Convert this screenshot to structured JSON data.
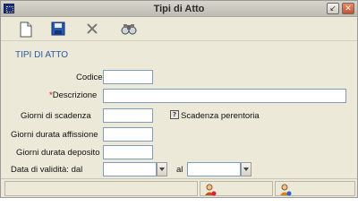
{
  "window": {
    "title": "Tipi di Atto",
    "min_glyph": "↙",
    "close_glyph": "✕"
  },
  "toolbar": {
    "items": [
      {
        "name": "new-document-icon"
      },
      {
        "name": "save-icon"
      },
      {
        "name": "delete-icon"
      },
      {
        "name": "search-binoculars-icon"
      }
    ]
  },
  "form": {
    "section_title": "TIPI DI ATTO",
    "codice_label": "Codice",
    "codice_value": "",
    "descrizione_required_mark": "*",
    "descrizione_label": "Descrizione",
    "descrizione_value": "",
    "giorni_scadenza_label": "Giorni di scadenza",
    "giorni_scadenza_value": "",
    "scadenza_perentoria_label": "Scadenza perentoria",
    "help_glyph": "?",
    "giorni_affissione_label": "Giorni durata affissione",
    "giorni_affissione_value": "",
    "giorni_deposito_label": "Giorni durata deposito",
    "giorni_deposito_value": "",
    "validita_dal_label": "Data di validità: dal",
    "validita_dal_value": "",
    "validita_al_label": "al",
    "validita_al_value": ""
  },
  "statusbar": {
    "icons": [
      "user-warning-icon",
      "user-info-icon"
    ]
  },
  "colors": {
    "section_title": "#2c5aa0",
    "required_mark": "#d01010",
    "field_border": "#7f9db9",
    "window_bg": "#ece9d8"
  }
}
